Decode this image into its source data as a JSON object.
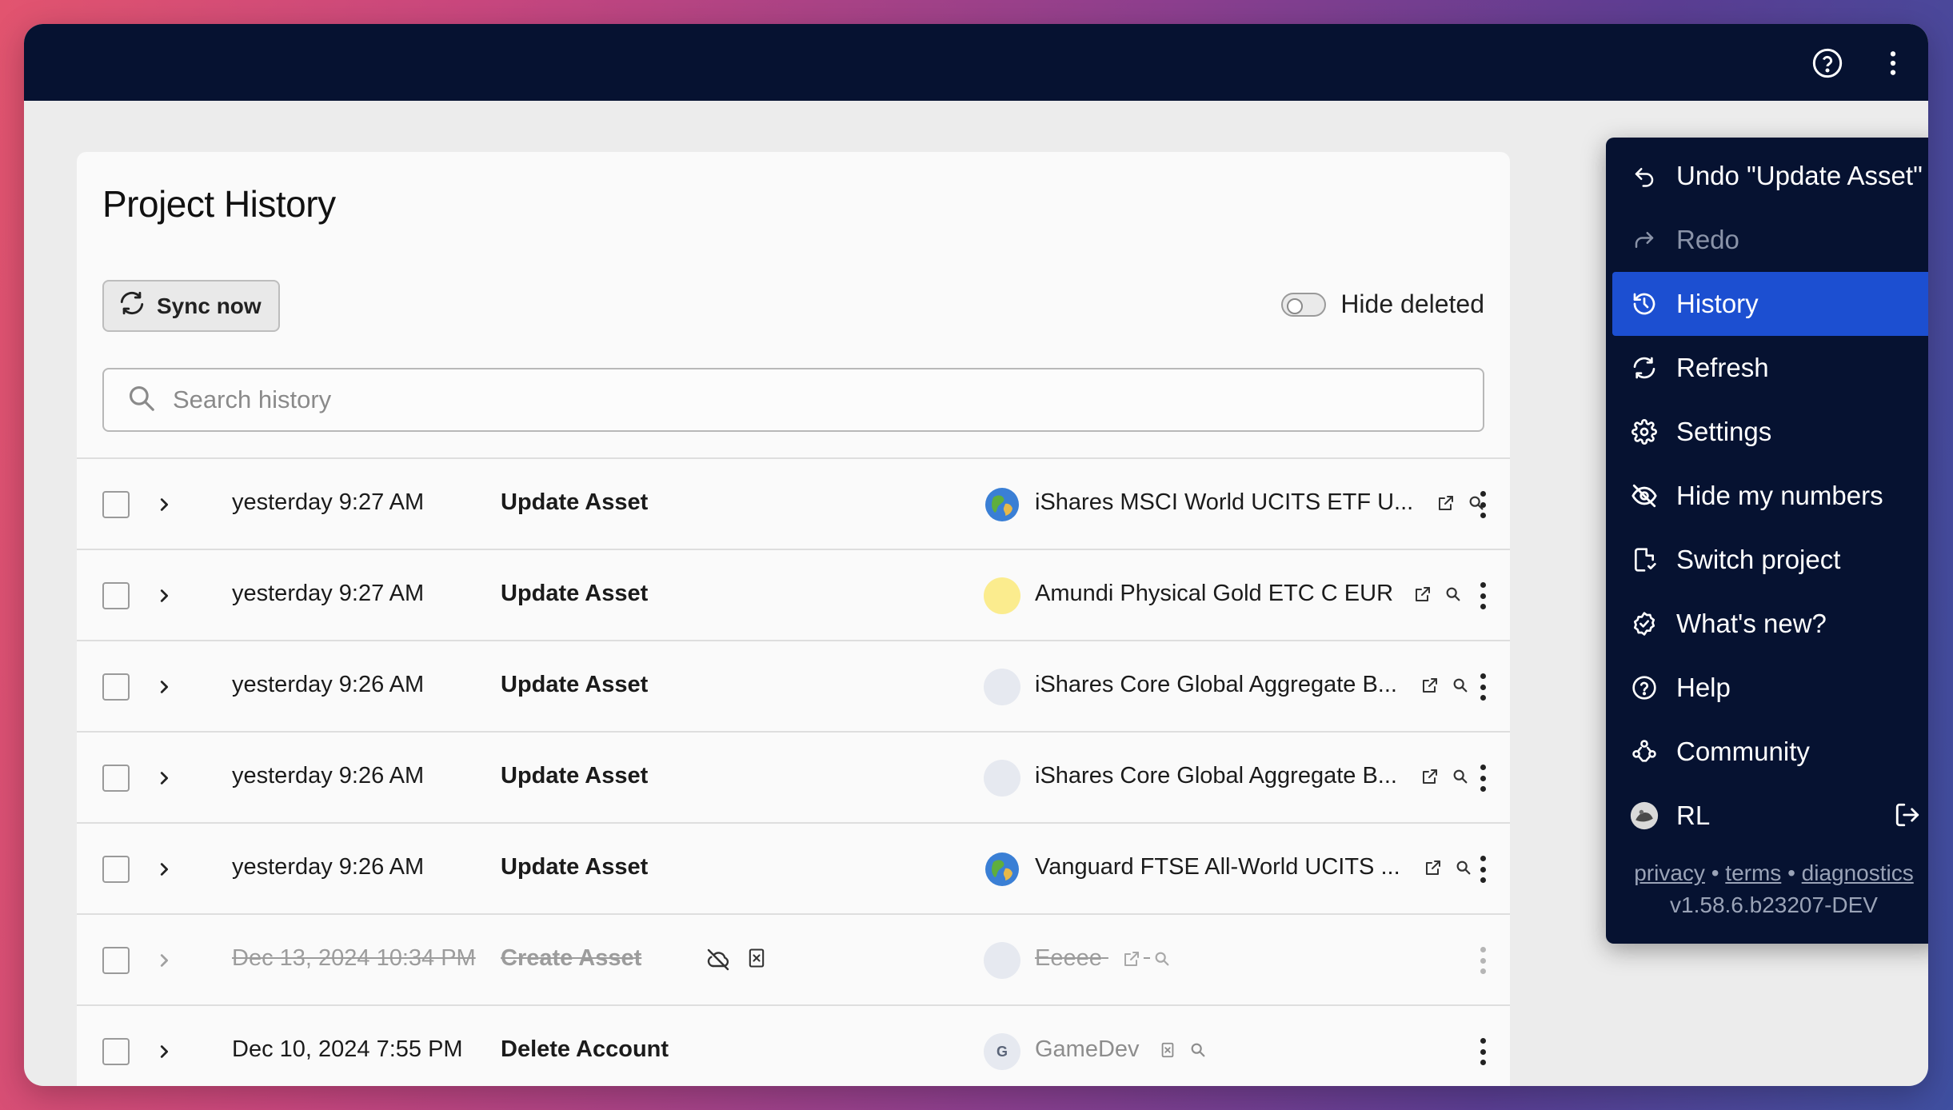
{
  "header": {
    "help_icon": "help-circle-icon",
    "more_icon": "more-vertical-icon"
  },
  "page": {
    "title": "Project History",
    "sync_label": "Sync now",
    "hide_deleted_label": "Hide deleted",
    "search_placeholder": "Search history"
  },
  "rows": [
    {
      "date": "yesterday 9:27 AM",
      "action": "Update Asset",
      "asset": "iShares MSCI World UCITS ETF U...",
      "avatar": "globe",
      "deleted": false
    },
    {
      "date": "yesterday 9:27 AM",
      "action": "Update Asset",
      "asset": "Amundi Physical Gold ETC C EUR",
      "avatar": "gold",
      "deleted": false
    },
    {
      "date": "yesterday 9:26 AM",
      "action": "Update Asset",
      "asset": "iShares Core Global Aggregate B...",
      "avatar": "blank",
      "deleted": false
    },
    {
      "date": "yesterday 9:26 AM",
      "action": "Update Asset",
      "asset": "iShares Core Global Aggregate B...",
      "avatar": "blank",
      "deleted": false
    },
    {
      "date": "yesterday 9:26 AM",
      "action": "Update Asset",
      "asset": "Vanguard FTSE All-World UCITS ...",
      "avatar": "globe",
      "deleted": false
    },
    {
      "date": "Dec 13, 2024 10:34 PM",
      "action": "Create Asset",
      "asset": "Eeeee",
      "avatar": "blank",
      "deleted": true
    },
    {
      "date": "Dec 10, 2024 7:55 PM",
      "action": "Delete Account",
      "asset": "GameDev",
      "avatar": "letter",
      "avatar_letter": "G",
      "deleted": false
    }
  ],
  "menu": {
    "items": [
      {
        "label": "Undo \"Update Asset\"",
        "icon": "undo-icon",
        "state": "normal"
      },
      {
        "label": "Redo",
        "icon": "redo-icon",
        "state": "disabled"
      },
      {
        "label": "History",
        "icon": "history-icon",
        "state": "active"
      },
      {
        "label": "Refresh",
        "icon": "refresh-icon",
        "state": "normal"
      },
      {
        "label": "Settings",
        "icon": "gear-icon",
        "state": "normal"
      },
      {
        "label": "Hide my numbers",
        "icon": "eye-off-icon",
        "state": "normal"
      },
      {
        "label": "Switch project",
        "icon": "file-switch-icon",
        "state": "normal"
      },
      {
        "label": "What's new?",
        "icon": "badge-check-icon",
        "state": "normal"
      },
      {
        "label": "Help",
        "icon": "help-circle-icon",
        "state": "normal"
      },
      {
        "label": "Community",
        "icon": "community-icon",
        "state": "normal"
      },
      {
        "label": "RL",
        "icon": "user-avatar",
        "state": "normal"
      }
    ],
    "footer": {
      "privacy": "privacy",
      "terms": "terms",
      "diagnostics": "diagnostics",
      "separator": "•",
      "version": "v1.58.6.b23207-DEV"
    }
  },
  "colors": {
    "topbar": "#061231",
    "menu_bg": "#061231",
    "menu_active": "#1c4fd1",
    "card_bg": "#fafafa"
  }
}
